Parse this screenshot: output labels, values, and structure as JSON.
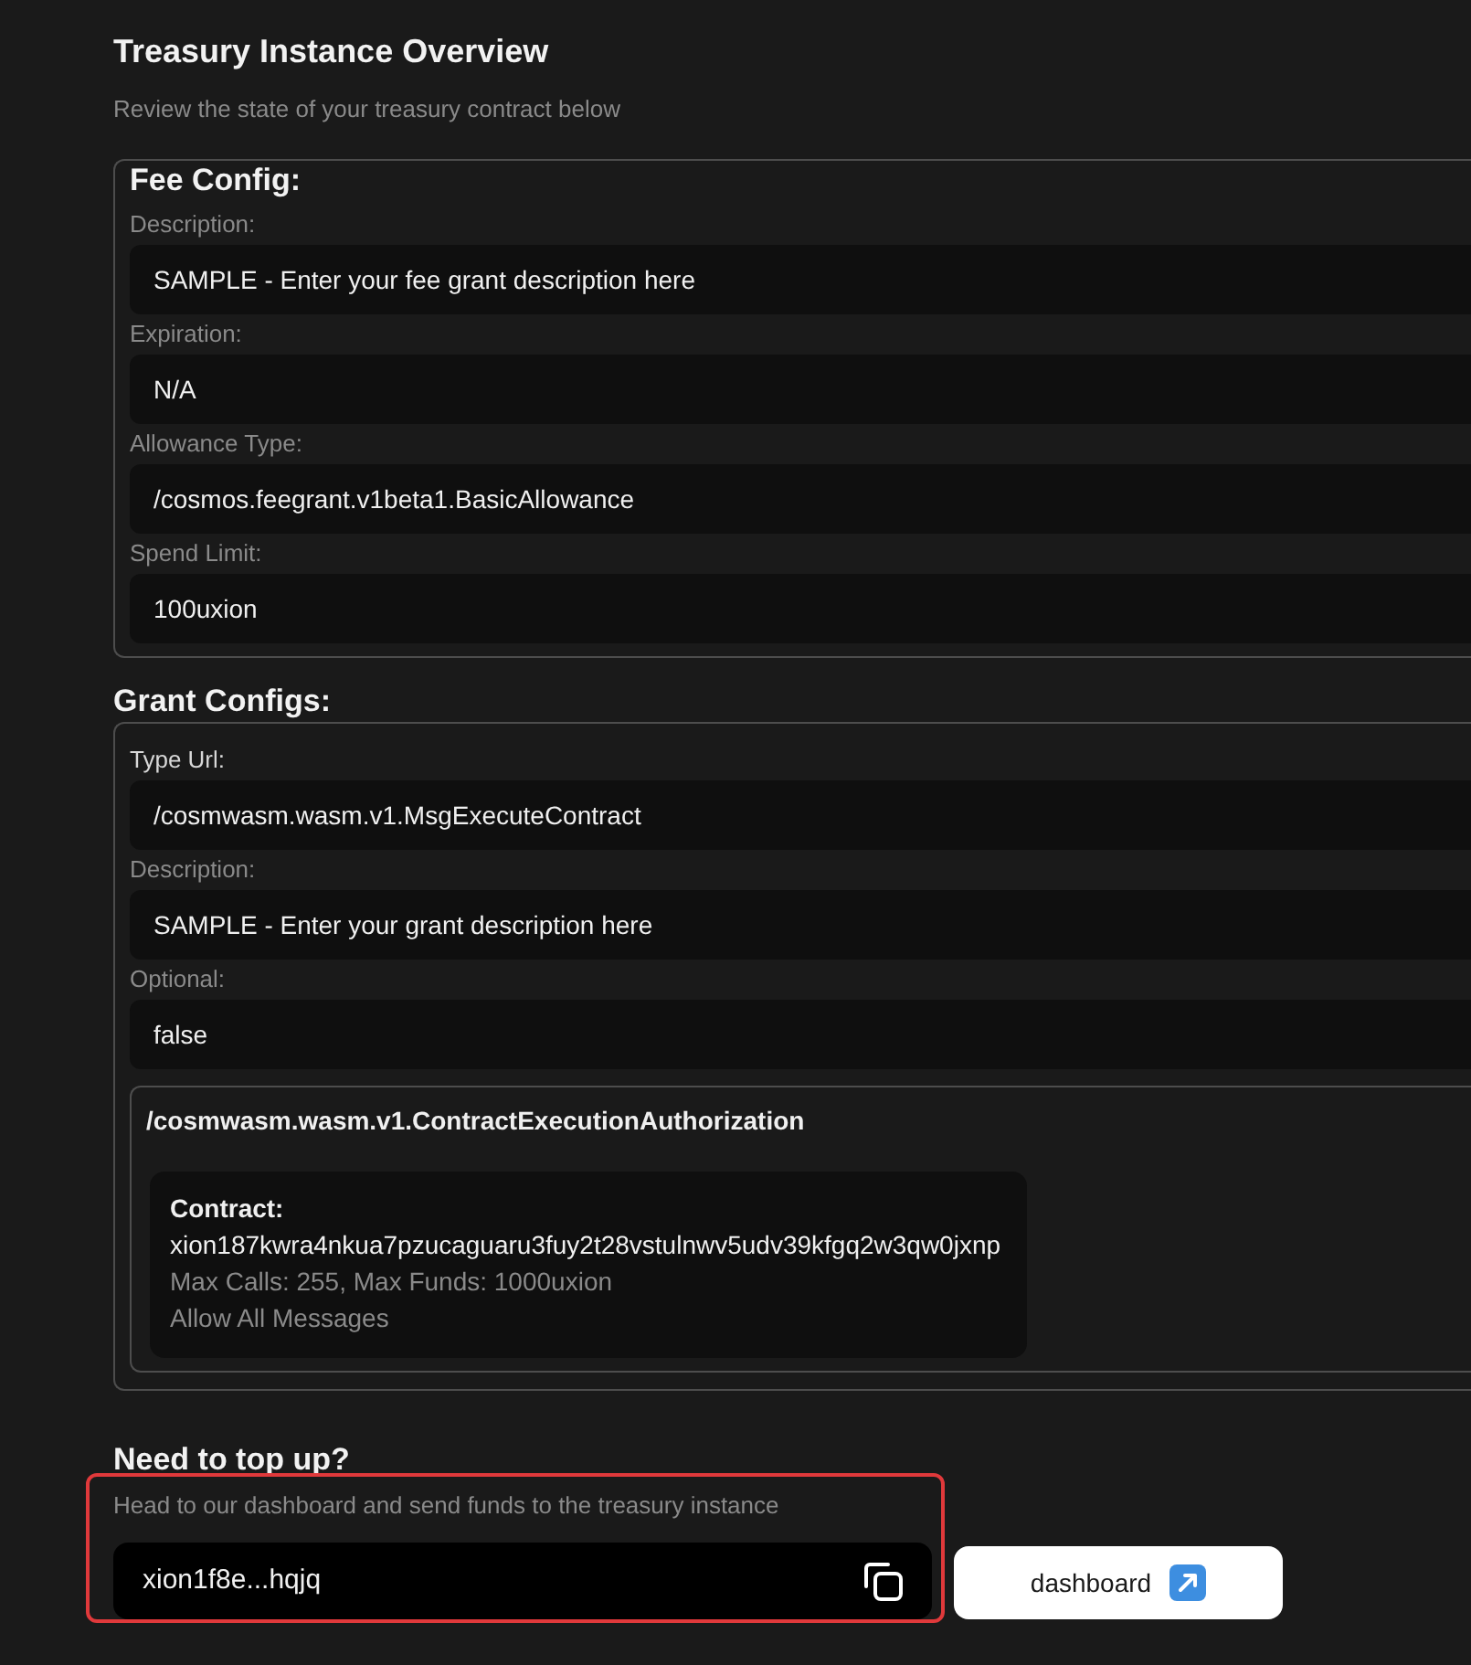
{
  "page": {
    "title": "Treasury Instance Overview",
    "subtitle": "Review the state of your treasury contract below"
  },
  "fee_config": {
    "heading": "Fee Config:",
    "fields": [
      {
        "label": "Description:",
        "muted": true,
        "value": "SAMPLE - Enter your fee grant description here"
      },
      {
        "label": "Expiration:",
        "muted": true,
        "value": "N/A"
      },
      {
        "label": "Allowance Type:",
        "muted": true,
        "value": "/cosmos.feegrant.v1beta1.BasicAllowance"
      },
      {
        "label": "Spend Limit:",
        "muted": true,
        "value": "100uxion"
      }
    ]
  },
  "grant_configs": {
    "heading": "Grant Configs:",
    "fields": [
      {
        "label": "Type Url:",
        "muted": false,
        "value": "/cosmwasm.wasm.v1.MsgExecuteContract"
      },
      {
        "label": "Description:",
        "muted": true,
        "value": "SAMPLE - Enter your grant description here"
      },
      {
        "label": "Optional:",
        "muted": true,
        "value": "false"
      }
    ],
    "authorization": {
      "type": "/cosmwasm.wasm.v1.ContractExecutionAuthorization",
      "contracts": [
        {
          "label": "Contract:",
          "address": "xion187kwra4nkua7pzucaguaru3fuy2t28vstulnwv5udv39kfgq2w3qw0jxnp",
          "limits": "Max Calls: 255, Max Funds: 1000uxion",
          "filter": "Allow All Messages"
        }
      ]
    }
  },
  "top_up": {
    "heading": "Need to top up?",
    "description": "Head to our dashboard and send funds to the treasury instance",
    "highlighted": true,
    "address": "xion1f8e...hqjq",
    "button": "dashboard"
  }
}
